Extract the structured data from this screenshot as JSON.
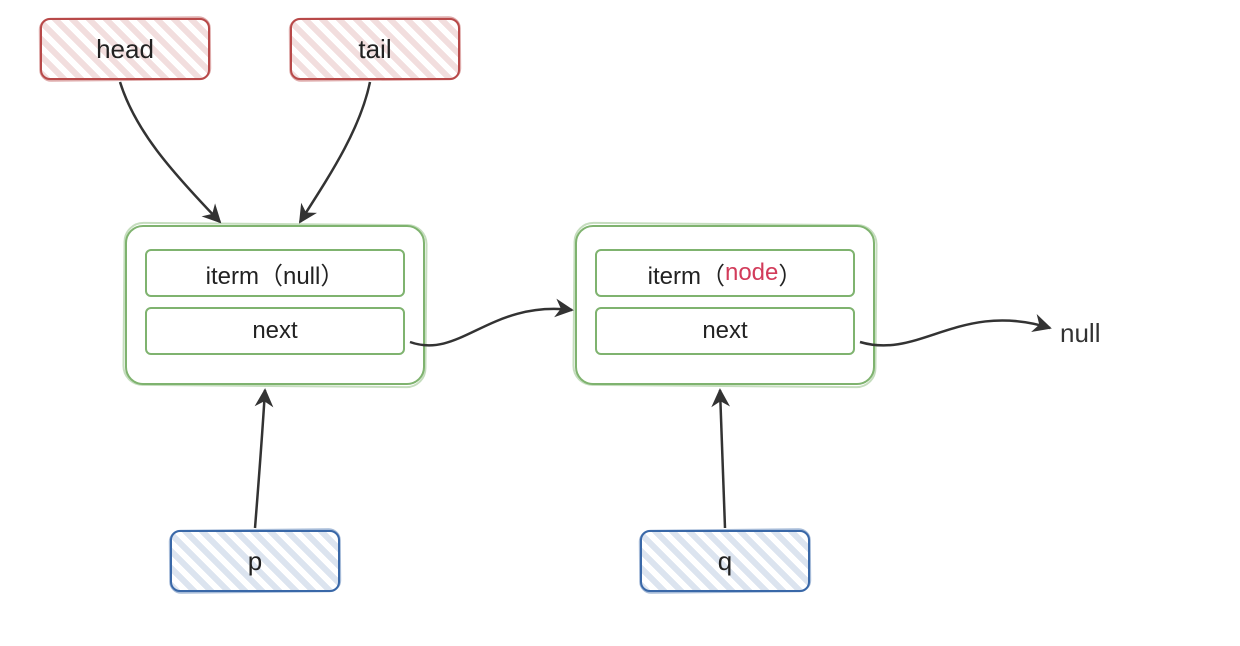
{
  "pointers": {
    "head": "head",
    "tail": "tail",
    "p": "p",
    "q": "q"
  },
  "node1": {
    "item_label": "iterm（null）",
    "next_label": "next"
  },
  "node2": {
    "item_prefix": "iterm（",
    "item_value": "node",
    "item_suffix": "）",
    "next_label": "next"
  },
  "terminal": {
    "null_label": "null"
  },
  "diagram": {
    "description": "Linked-list sketch: head and tail both point to the first node (item=null). Pointer p also references the first node. The first node's next points to a second node (item=node), referenced by q. The second node's next points to null.",
    "edges": [
      {
        "from": "head",
        "to": "node1"
      },
      {
        "from": "tail",
        "to": "node1"
      },
      {
        "from": "p",
        "to": "node1"
      },
      {
        "from": "node1.next",
        "to": "node2"
      },
      {
        "from": "q",
        "to": "node2"
      },
      {
        "from": "node2.next",
        "to": "null"
      }
    ]
  }
}
